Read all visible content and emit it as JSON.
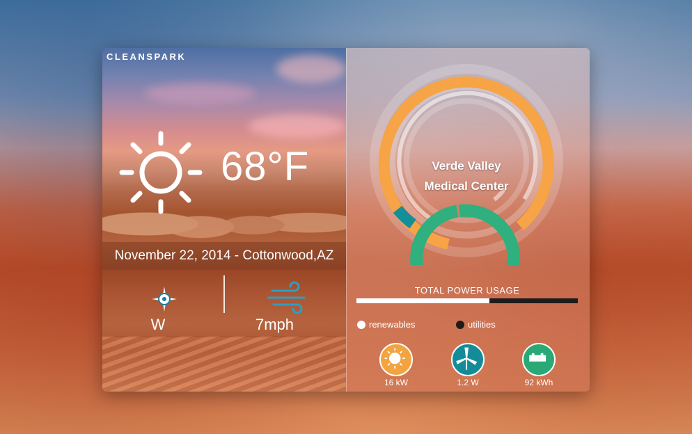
{
  "app": {
    "logo_text": "CLEANSPARK"
  },
  "weather": {
    "temperature": "68°F",
    "date_location": "November 22, 2014 - Cottonwood,AZ",
    "wind_direction": "W",
    "wind_speed": "7mph",
    "icons": [
      "sun-icon",
      "compass-icon",
      "wind-icon"
    ]
  },
  "facility": {
    "name": "Verde Valley Medical Center"
  },
  "power": {
    "label": "TOTAL POWER USAGE",
    "bar_fill_fraction": 0.6,
    "legend": [
      {
        "label": "renewables",
        "color": "#ffffff"
      },
      {
        "label": "utilities",
        "color": "#1f1b1b"
      }
    ],
    "sources": [
      {
        "icon": "solar-icon",
        "value": "16 kW",
        "color": "#f3a33f"
      },
      {
        "icon": "wind-turbine-icon",
        "value": "1.2 W",
        "color": "#148c97"
      },
      {
        "icon": "battery-icon",
        "value": "92 kWh",
        "color": "#2aa977"
      }
    ]
  },
  "colors": {
    "orange": "#f6a445",
    "green": "#2fb07e",
    "teal": "#138f99"
  }
}
